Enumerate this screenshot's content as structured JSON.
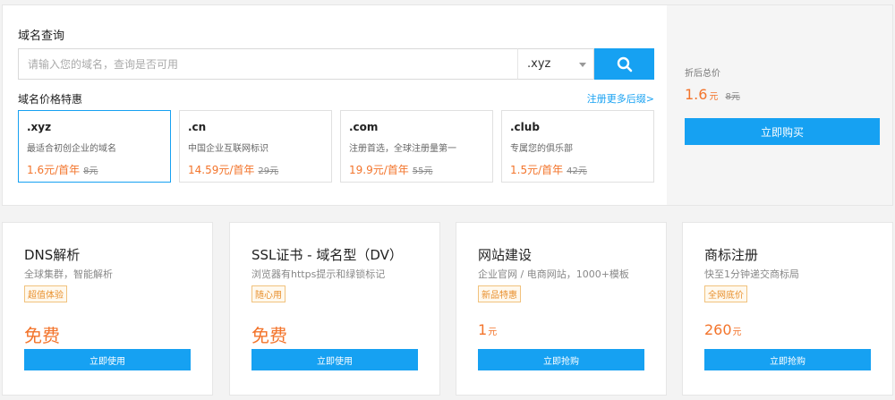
{
  "domain_search": {
    "title": "域名查询",
    "placeholder": "请输入您的域名，查询是否可用",
    "suffix_selected": ".xyz",
    "search_icon": "search-icon"
  },
  "domain_prices": {
    "title": "域名价格特惠",
    "more_link": "注册更多后缀>",
    "cards": [
      {
        "name": ".xyz",
        "desc": "最适合初创企业的域名",
        "price": "1.6元/首年",
        "orig": "8元"
      },
      {
        "name": ".cn",
        "desc": "中国企业互联网标识",
        "price": "14.59元/首年",
        "orig": "29元"
      },
      {
        "name": ".com",
        "desc": "注册首选，全球注册量第一",
        "price": "19.9元/首年",
        "orig": "55元"
      },
      {
        "name": ".club",
        "desc": "专属您的俱乐部",
        "price": "1.5元/首年",
        "orig": "42元"
      }
    ]
  },
  "summary": {
    "label": "折后总价",
    "price": "1.6",
    "unit": "元",
    "orig": "8元",
    "buy_label": "立即购买"
  },
  "products": [
    {
      "title": "DNS解析",
      "sub": "全球集群，智能解析",
      "tag": "超值体验",
      "price_big": "免费",
      "price_num": "",
      "unit": "",
      "button": "立即使用"
    },
    {
      "title": "SSL证书 - 域名型（DV）",
      "sub": "浏览器有https提示和绿锁标记",
      "tag": "随心用",
      "price_big": "免费",
      "price_num": "",
      "unit": "",
      "button": "立即使用"
    },
    {
      "title": "网站建设",
      "sub": "企业官网 / 电商网站，1000+模板",
      "tag": "新品特惠",
      "price_big": "",
      "price_num": "1",
      "unit": "元",
      "button": "立即抢购"
    },
    {
      "title": "商标注册",
      "sub": "快至1分钟递交商标局",
      "tag": "全网底价",
      "price_big": "",
      "price_num": "260",
      "unit": "元",
      "button": "立即抢购"
    }
  ],
  "colors": {
    "accent": "#16a1f2",
    "price": "#f3742b"
  }
}
